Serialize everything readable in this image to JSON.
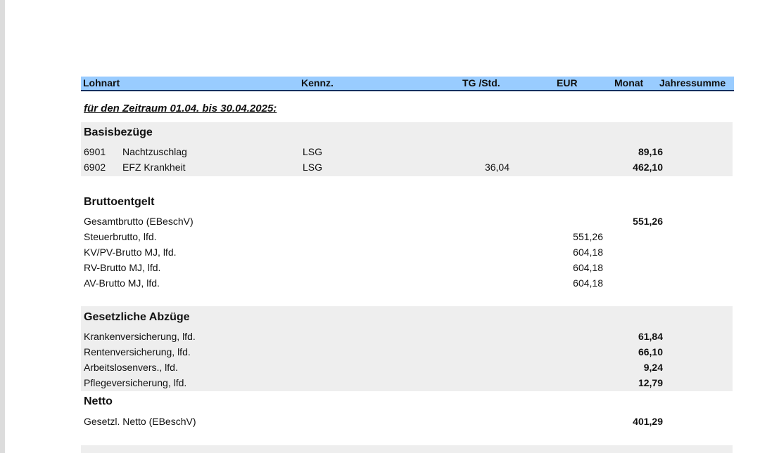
{
  "header": {
    "lohnart": "Lohnart",
    "kennz": "Kennz.",
    "tg_std": "TG /Std.",
    "eur": "EUR",
    "monat": "Monat",
    "jahressumme": "Jahressumme"
  },
  "period": "für den Zeitraum 01.04. bis 30.04.2025:",
  "basis": {
    "title": "Basisbezüge",
    "rows": [
      {
        "code": "6901",
        "name": "Nachtzuschlag",
        "kennz": "LSG",
        "tg": "",
        "eur": "",
        "monat": "89,16"
      },
      {
        "code": "6902",
        "name": "EFZ Krankheit",
        "kennz": "LSG",
        "tg": "36,04",
        "eur": "",
        "monat": "462,10"
      }
    ]
  },
  "brutto": {
    "title": "Bruttoentgelt",
    "rows": [
      {
        "label": "Gesamtbrutto (EBeschV)",
        "eur": "",
        "monat": "551,26"
      },
      {
        "label": "Steuerbrutto, lfd.",
        "eur": "551,26",
        "monat": ""
      },
      {
        "label": "KV/PV-Brutto MJ, lfd.",
        "eur": "604,18",
        "monat": ""
      },
      {
        "label": "RV-Brutto MJ, lfd.",
        "eur": "604,18",
        "monat": ""
      },
      {
        "label": "AV-Brutto MJ, lfd.",
        "eur": "604,18",
        "monat": ""
      }
    ]
  },
  "abzuege": {
    "title": "Gesetzliche Abzüge",
    "rows": [
      {
        "label": "Krankenversicherung, lfd.",
        "monat": "61,84"
      },
      {
        "label": "Rentenversicherung, lfd.",
        "monat": "66,10"
      },
      {
        "label": "Arbeitslosenvers., lfd.",
        "monat": "9,24"
      },
      {
        "label": "Pflegeversicherung, lfd.",
        "monat": "12,79"
      }
    ]
  },
  "netto": {
    "title": "Netto",
    "rows": [
      {
        "label": "Gesetzl. Netto (EBeschV)",
        "monat": "401,29"
      }
    ]
  }
}
